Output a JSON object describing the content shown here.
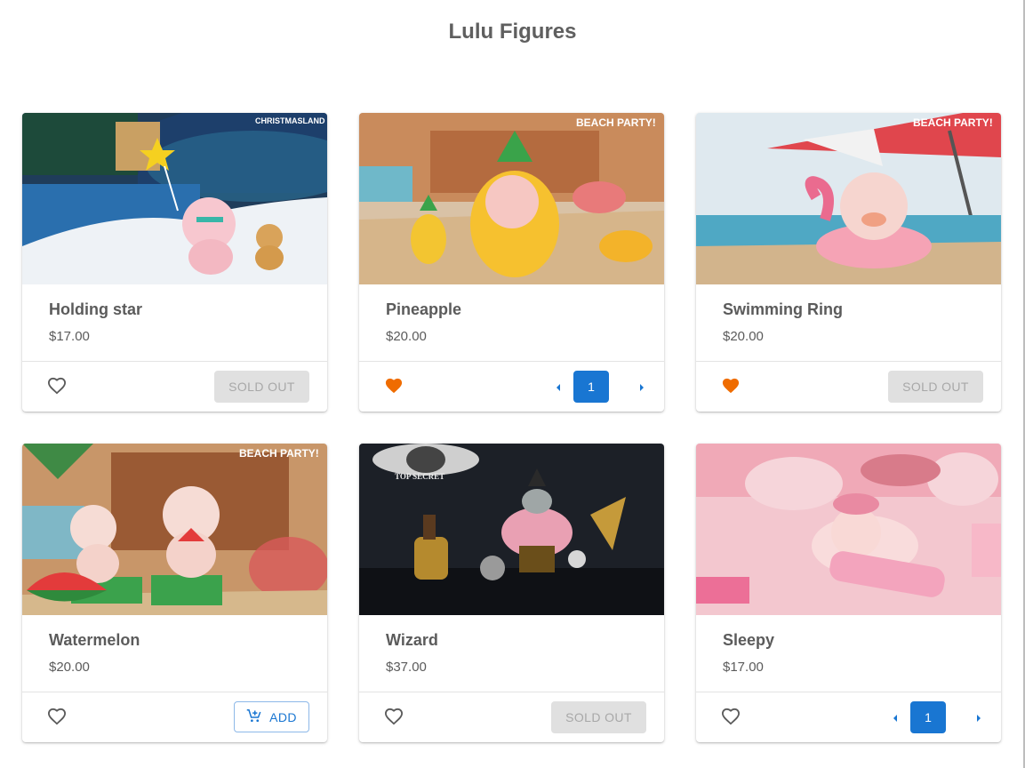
{
  "page": {
    "title": "Lulu Figures"
  },
  "colors": {
    "accent": "#1976d2",
    "favorite": "#ef6c00",
    "disabled_bg": "#e0e0e0",
    "disabled_text": "#a8a8a8"
  },
  "products": [
    {
      "name": "Holding star",
      "price": "$17.00",
      "favorite": false,
      "action": "sold_out",
      "action_label": "SOLD OUT",
      "banner": "CHRISTMASLAND"
    },
    {
      "name": "Pineapple",
      "price": "$20.00",
      "favorite": true,
      "action": "stepper",
      "quantity": "1",
      "banner": "BEACH PARTY!"
    },
    {
      "name": "Swimming Ring",
      "price": "$20.00",
      "favorite": true,
      "action": "sold_out",
      "action_label": "SOLD OUT",
      "banner": "BEACH PARTY!"
    },
    {
      "name": "Watermelon",
      "price": "$20.00",
      "favorite": false,
      "action": "add",
      "action_label": "ADD",
      "banner": "BEACH PARTY!"
    },
    {
      "name": "Wizard",
      "price": "$37.00",
      "favorite": false,
      "action": "sold_out",
      "action_label": "SOLD OUT",
      "banner": "TOP SECRET"
    },
    {
      "name": "Sleepy",
      "price": "$17.00",
      "favorite": false,
      "action": "stepper",
      "quantity": "1",
      "banner": ""
    }
  ]
}
